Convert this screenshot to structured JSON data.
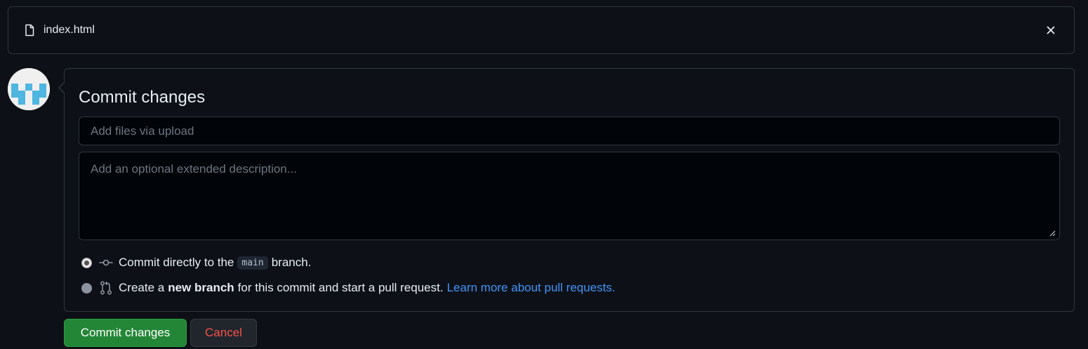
{
  "file": {
    "name": "index.html",
    "icon": "file-icon",
    "close_icon": "close-icon"
  },
  "avatar": {
    "icon": "identicon-avatar",
    "color": "#4eb6e0"
  },
  "commit": {
    "title": "Commit changes",
    "summary_placeholder": "Add files via upload",
    "description_placeholder": "Add an optional extended description...",
    "options": [
      {
        "selected": true,
        "icon": "git-commit-icon",
        "text_before": "Commit directly to the",
        "branch": "main",
        "text_after": "branch."
      },
      {
        "selected": false,
        "icon": "git-pull-request-icon",
        "text_before": "Create a",
        "bold": "new branch",
        "text_after": "for this commit and start a pull request.",
        "link": "Learn more about pull requests."
      }
    ]
  },
  "buttons": {
    "commit_label": "Commit changes",
    "cancel_label": "Cancel"
  },
  "colors": {
    "background": "#0d1117",
    "border": "#30363d",
    "primary_button": "#238636",
    "danger_text": "#f85149",
    "link": "#4493f8"
  }
}
